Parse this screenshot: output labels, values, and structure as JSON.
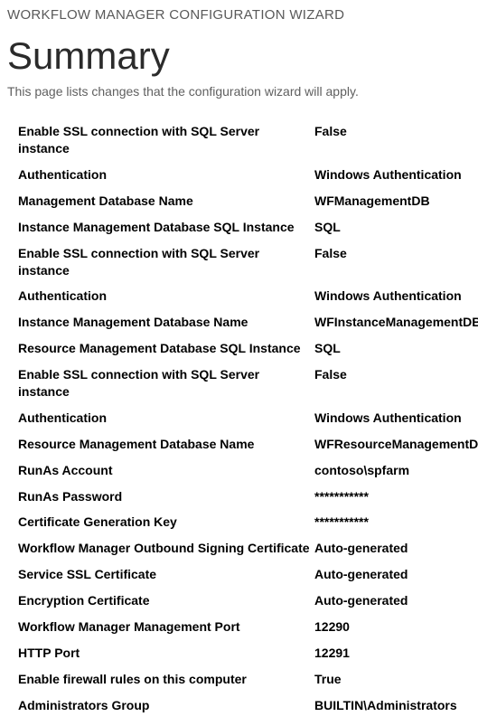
{
  "header": {
    "wizard_title": "WORKFLOW MANAGER CONFIGURATION WIZARD",
    "page_title": "Summary",
    "description": "This page lists changes that the configuration wizard will apply."
  },
  "settings": [
    {
      "label": "Enable SSL connection with SQL Server instance",
      "value": "False"
    },
    {
      "label": "Authentication",
      "value": "Windows Authentication"
    },
    {
      "label": "Management Database Name",
      "value": "WFManagementDB"
    },
    {
      "label": "Instance Management Database SQL Instance",
      "value": "SQL"
    },
    {
      "label": "Enable SSL connection with SQL Server instance",
      "value": "False"
    },
    {
      "label": "Authentication",
      "value": "Windows Authentication"
    },
    {
      "label": "Instance Management Database Name",
      "value": "WFInstanceManagementDB"
    },
    {
      "label": "Resource Management Database SQL Instance",
      "value": "SQL"
    },
    {
      "label": "Enable SSL connection with SQL Server instance",
      "value": "False"
    },
    {
      "label": "Authentication",
      "value": "Windows Authentication"
    },
    {
      "label": "Resource Management Database Name",
      "value": "WFResourceManagementDB"
    },
    {
      "label": "RunAs Account",
      "value": "contoso\\spfarm"
    },
    {
      "label": "RunAs Password",
      "value": "***********"
    },
    {
      "label": "Certificate Generation Key",
      "value": "***********"
    },
    {
      "label": "Workflow Manager Outbound Signing Certificate",
      "value": "Auto-generated"
    },
    {
      "label": "Service SSL Certificate",
      "value": "Auto-generated"
    },
    {
      "label": "Encryption Certificate",
      "value": "Auto-generated"
    },
    {
      "label": "Workflow Manager Management Port",
      "value": "12290"
    },
    {
      "label": "HTTP Port",
      "value": "12291"
    },
    {
      "label": "Enable firewall rules on this computer",
      "value": "True"
    },
    {
      "label": "Administrators Group",
      "value": "BUILTIN\\Administrators"
    }
  ]
}
